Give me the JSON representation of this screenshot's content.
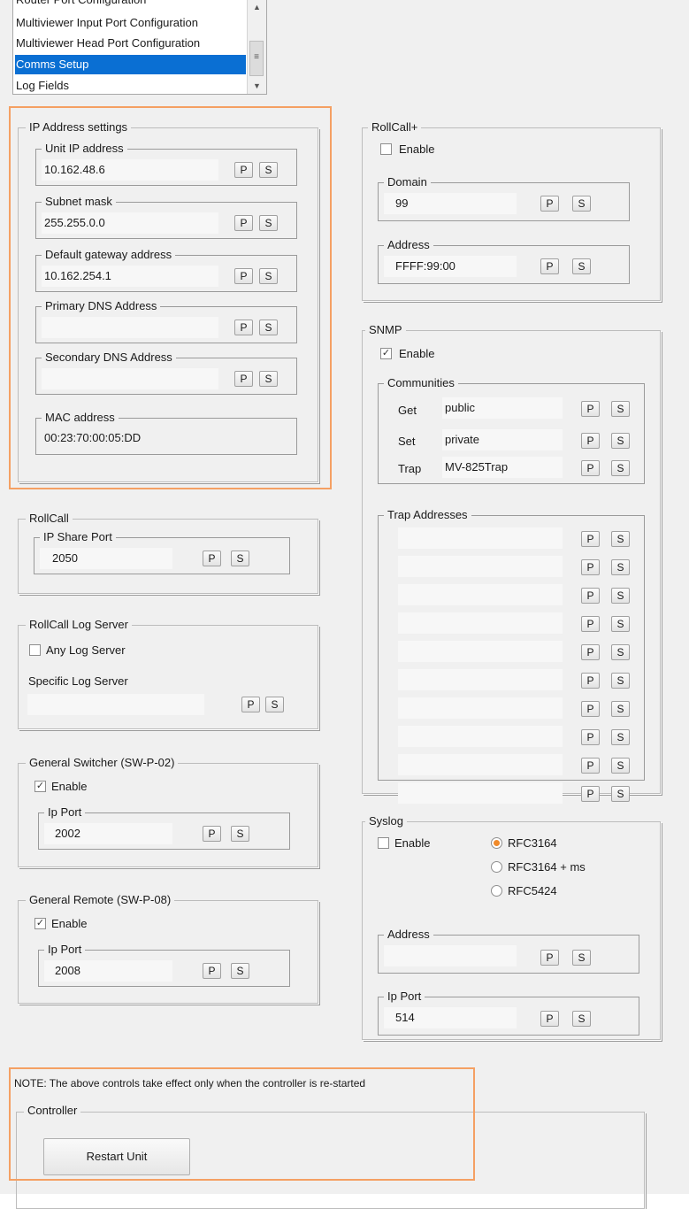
{
  "config_list": {
    "items": [
      "Router Port Configuration",
      "Multiviewer Input Port Configuration",
      "Multiviewer Head Port Configuration",
      "Comms Setup",
      "Log Fields"
    ],
    "selected": "Comms Setup"
  },
  "buttons": {
    "p": "P",
    "s": "S",
    "restart": "Restart Unit"
  },
  "ip_settings": {
    "title": "IP Address settings",
    "unit_ip": {
      "label": "Unit IP address",
      "value": "10.162.48.6"
    },
    "subnet": {
      "label": "Subnet mask",
      "value": "255.255.0.0"
    },
    "gateway": {
      "label": "Default gateway address",
      "value": "10.162.254.1"
    },
    "primary_dns": {
      "label": "Primary DNS Address",
      "value": ""
    },
    "secondary_dns": {
      "label": "Secondary DNS Address",
      "value": ""
    },
    "mac": {
      "label": "MAC address",
      "value": "00:23:70:00:05:DD"
    }
  },
  "rollcall": {
    "title": "RollCall",
    "share_port_label": "IP Share Port",
    "share_port": "2050"
  },
  "log_server": {
    "title": "RollCall Log Server",
    "any_label": "Any Log Server",
    "any_checked": false,
    "specific_label": "Specific Log Server",
    "specific_value": ""
  },
  "switcher": {
    "title": "General Switcher (SW-P-02)",
    "enable_label": "Enable",
    "enabled": true,
    "port_label": "Ip Port",
    "port": "2002"
  },
  "remote": {
    "title": "General Remote (SW-P-08)",
    "enable_label": "Enable",
    "enabled": true,
    "port_label": "Ip Port",
    "port": "2008"
  },
  "rollcall_plus": {
    "title": "RollCall+",
    "enable_label": "Enable",
    "enabled": false,
    "domain_label": "Domain",
    "domain": "99",
    "address_label": "Address",
    "address": "FFFF:99:00"
  },
  "snmp": {
    "title": "SNMP",
    "enable_label": "Enable",
    "enabled": true,
    "communities_label": "Communities",
    "communities": [
      {
        "label": "Get",
        "value": "public"
      },
      {
        "label": "Set",
        "value": "private"
      },
      {
        "label": "Trap",
        "value": "MV-825Trap"
      }
    ],
    "trap_label": "Trap Addresses",
    "trap_addresses": [
      "",
      "",
      "",
      "",
      "",
      "",
      "",
      "",
      "",
      ""
    ]
  },
  "syslog": {
    "title": "Syslog",
    "enable_label": "Enable",
    "enabled": false,
    "formats": [
      "RFC3164",
      "RFC3164 + ms",
      "RFC5424"
    ],
    "selected_format": "RFC3164",
    "address_label": "Address",
    "address": "",
    "port_label": "Ip Port",
    "port": "514"
  },
  "note": "NOTE: The above controls take effect only when the controller is re-started",
  "controller": {
    "title": "Controller"
  },
  "colors": {
    "highlight": "#f5a063",
    "selection": "#0a6fd3",
    "radio_dot": "#f08a2a"
  },
  "icons": {
    "scroll_up": "triangle-up-icon",
    "scroll_down": "triangle-down-icon",
    "scroll_grip": "grip-lines-icon"
  }
}
